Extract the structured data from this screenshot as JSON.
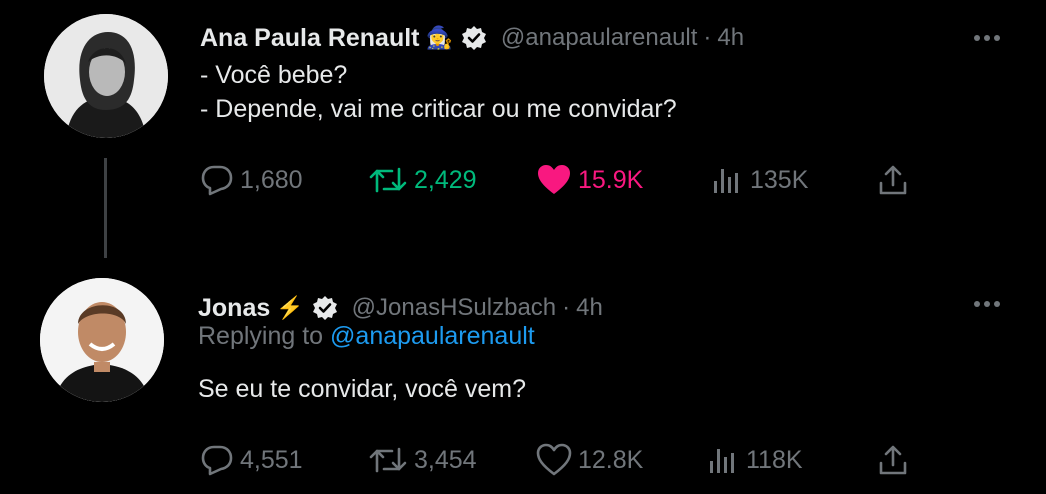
{
  "colors": {
    "background": "#000000",
    "text": "#e7e9ea",
    "muted": "#71767b",
    "link": "#1d9bf0",
    "retweeted": "#00ba7c",
    "liked": "#f91880"
  },
  "tweets": [
    {
      "author_name": "Ana Paula Renault",
      "author_emoji": "🧙‍♀️",
      "handle": "@anapaularenault",
      "time": "4h",
      "lines": [
        "- Você bebe?",
        "- Depende, vai me criticar ou me convidar?"
      ],
      "replies": "1,680",
      "retweets": "2,429",
      "likes": "15.9K",
      "views": "135K",
      "liked": true,
      "retweeted": true
    },
    {
      "author_name": "Jonas",
      "author_emoji": "⚡",
      "handle": "@JonasHSulzbach",
      "time": "4h",
      "replying_label": "Replying to",
      "replying_handle": "@anapaularenault",
      "text": "Se eu te convidar, você vem?",
      "replies": "4,551",
      "retweets": "3,454",
      "likes": "12.8K",
      "views": "118K",
      "liked": false,
      "retweeted": false
    }
  ],
  "icons": [
    "reply-icon",
    "retweet-icon",
    "heart-icon",
    "views-icon",
    "share-icon",
    "more-icon",
    "verified-icon"
  ]
}
